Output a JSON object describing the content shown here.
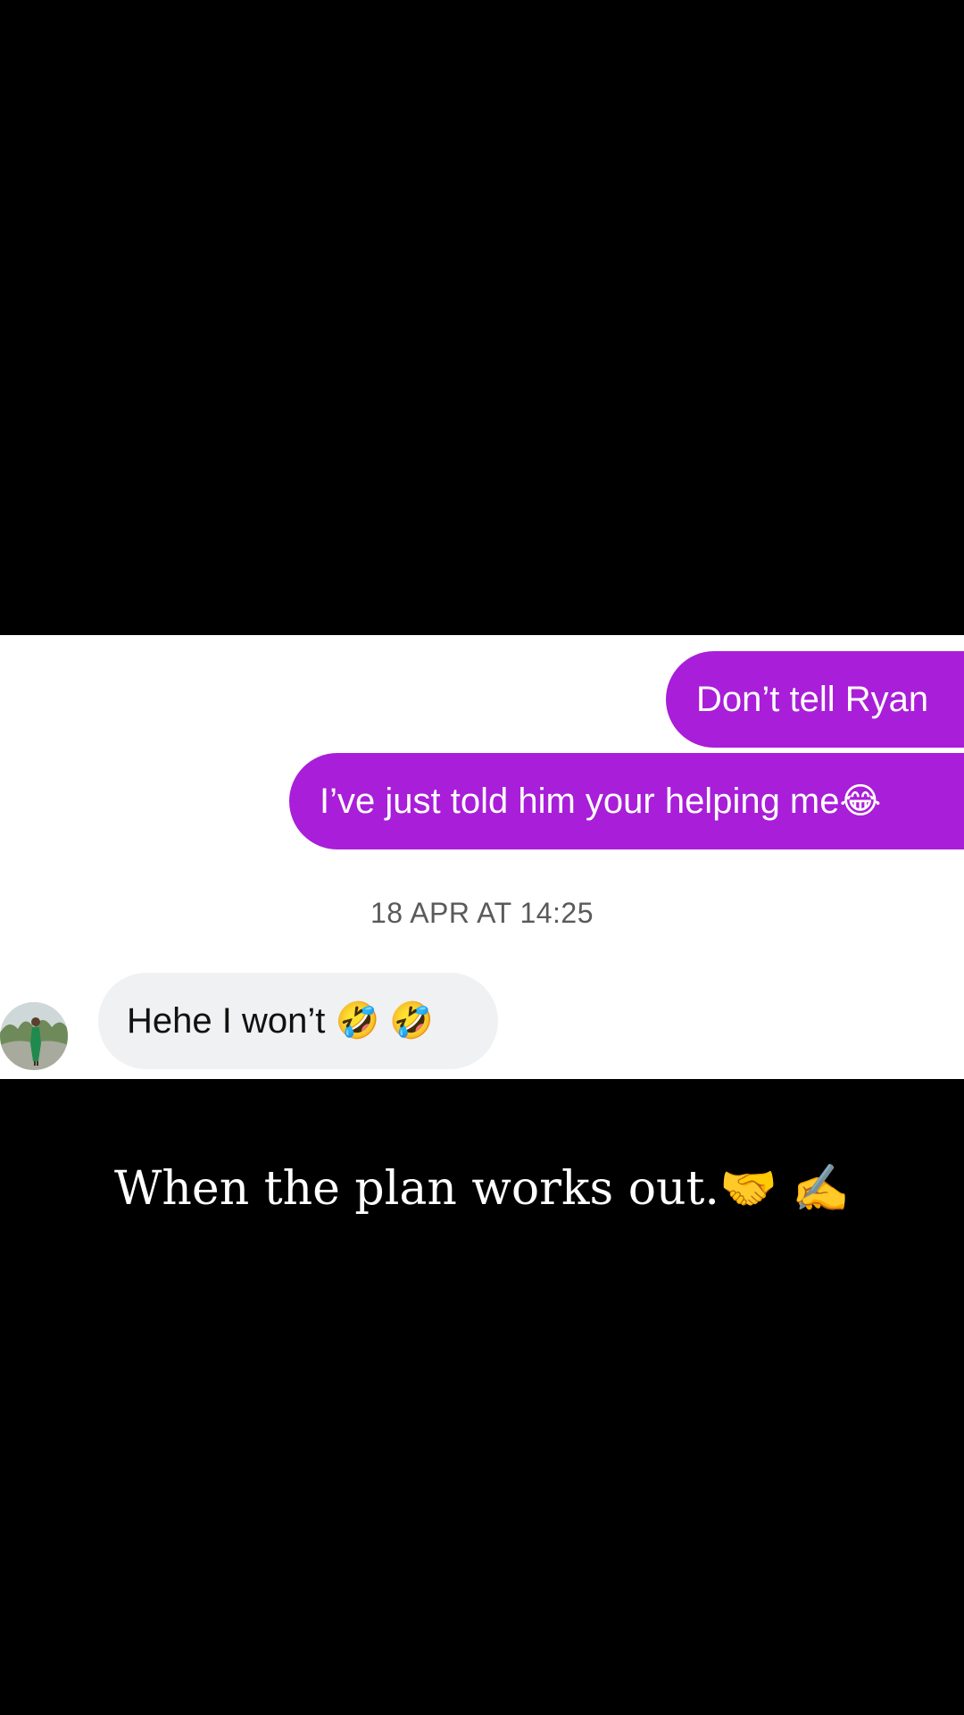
{
  "chat": {
    "messages": [
      {
        "direction": "outgoing",
        "text": "Don’t tell Ryan"
      },
      {
        "direction": "outgoing",
        "text": "I’ve just told him your helping me😂"
      }
    ],
    "timestamp": "18 APR AT 14:25",
    "reply": {
      "direction": "incoming",
      "text": "Hehe I won’t 🤣 🤣"
    }
  },
  "caption": "When the plan works out.🤝  ✍️",
  "colors": {
    "outgoing_bubble": "#a91ed8",
    "incoming_bubble": "#eff1f2",
    "background": "#000000",
    "chat_background": "#ffffff"
  },
  "icons": {
    "avatar": "contact-avatar-photo"
  }
}
